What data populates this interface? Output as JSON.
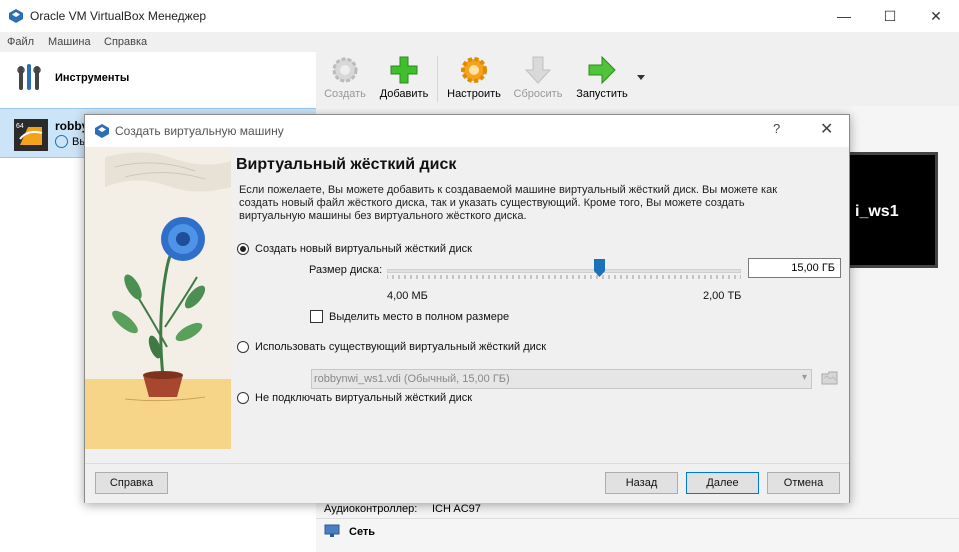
{
  "window": {
    "title": "Oracle VM VirtualBox Менеджер",
    "title_cut": "",
    "minimize": "—",
    "maximize": "☐",
    "close": "✕"
  },
  "menu": {
    "items": [
      "Файл",
      "Машина",
      "Справка"
    ]
  },
  "sidebar": {
    "tools_label": "Инструменты",
    "vm": {
      "name": "robby",
      "state": "Вы",
      "badge": "64"
    }
  },
  "toolbar": {
    "create": "Создать",
    "add": "Добавить",
    "settings": "Настроить",
    "discard": "Сбросить",
    "start": "Запустить"
  },
  "details": {
    "preview_text": "i_ws1",
    "audio_label": "Аудиоконтроллер:",
    "audio_value": "ICH AC97",
    "network_title": "Сеть"
  },
  "dialog": {
    "title": "Создать виртуальную машину",
    "help": "?",
    "close": "✕",
    "heading": "Виртуальный жёсткий диск",
    "description": "Если пожелаете, Вы можете добавить к создаваемой машине виртуальный жёсткий диск. Вы можете как создать новый файл жёсткого диска, так и указать существующий. Кроме того, Вы можете создать виртуальную машины без виртуального жёсткого диска.",
    "option_create": "Создать новый виртуальный жёсткий диск",
    "size_label": "Размер диска:",
    "size_value": "15,00 ГБ",
    "size_fraction": 0.6,
    "size_min": "4,00 МБ",
    "size_max": "2,00 ТБ",
    "preallocate": "Выделить место в полном размере",
    "option_existing": "Использовать существующий виртуальный жёсткий диск",
    "existing_disk": "robbynwi_ws1.vdi (Обычный, 15,00 ГБ)",
    "option_none": "Не подключать виртуальный жёсткий диск",
    "buttons": {
      "help": "Справка",
      "back": "Назад",
      "next": "Далее",
      "cancel": "Отмена"
    }
  },
  "colors": {
    "accent": "#0078d7",
    "selection": "#cce4f7",
    "thumb": "#1c72b8"
  }
}
